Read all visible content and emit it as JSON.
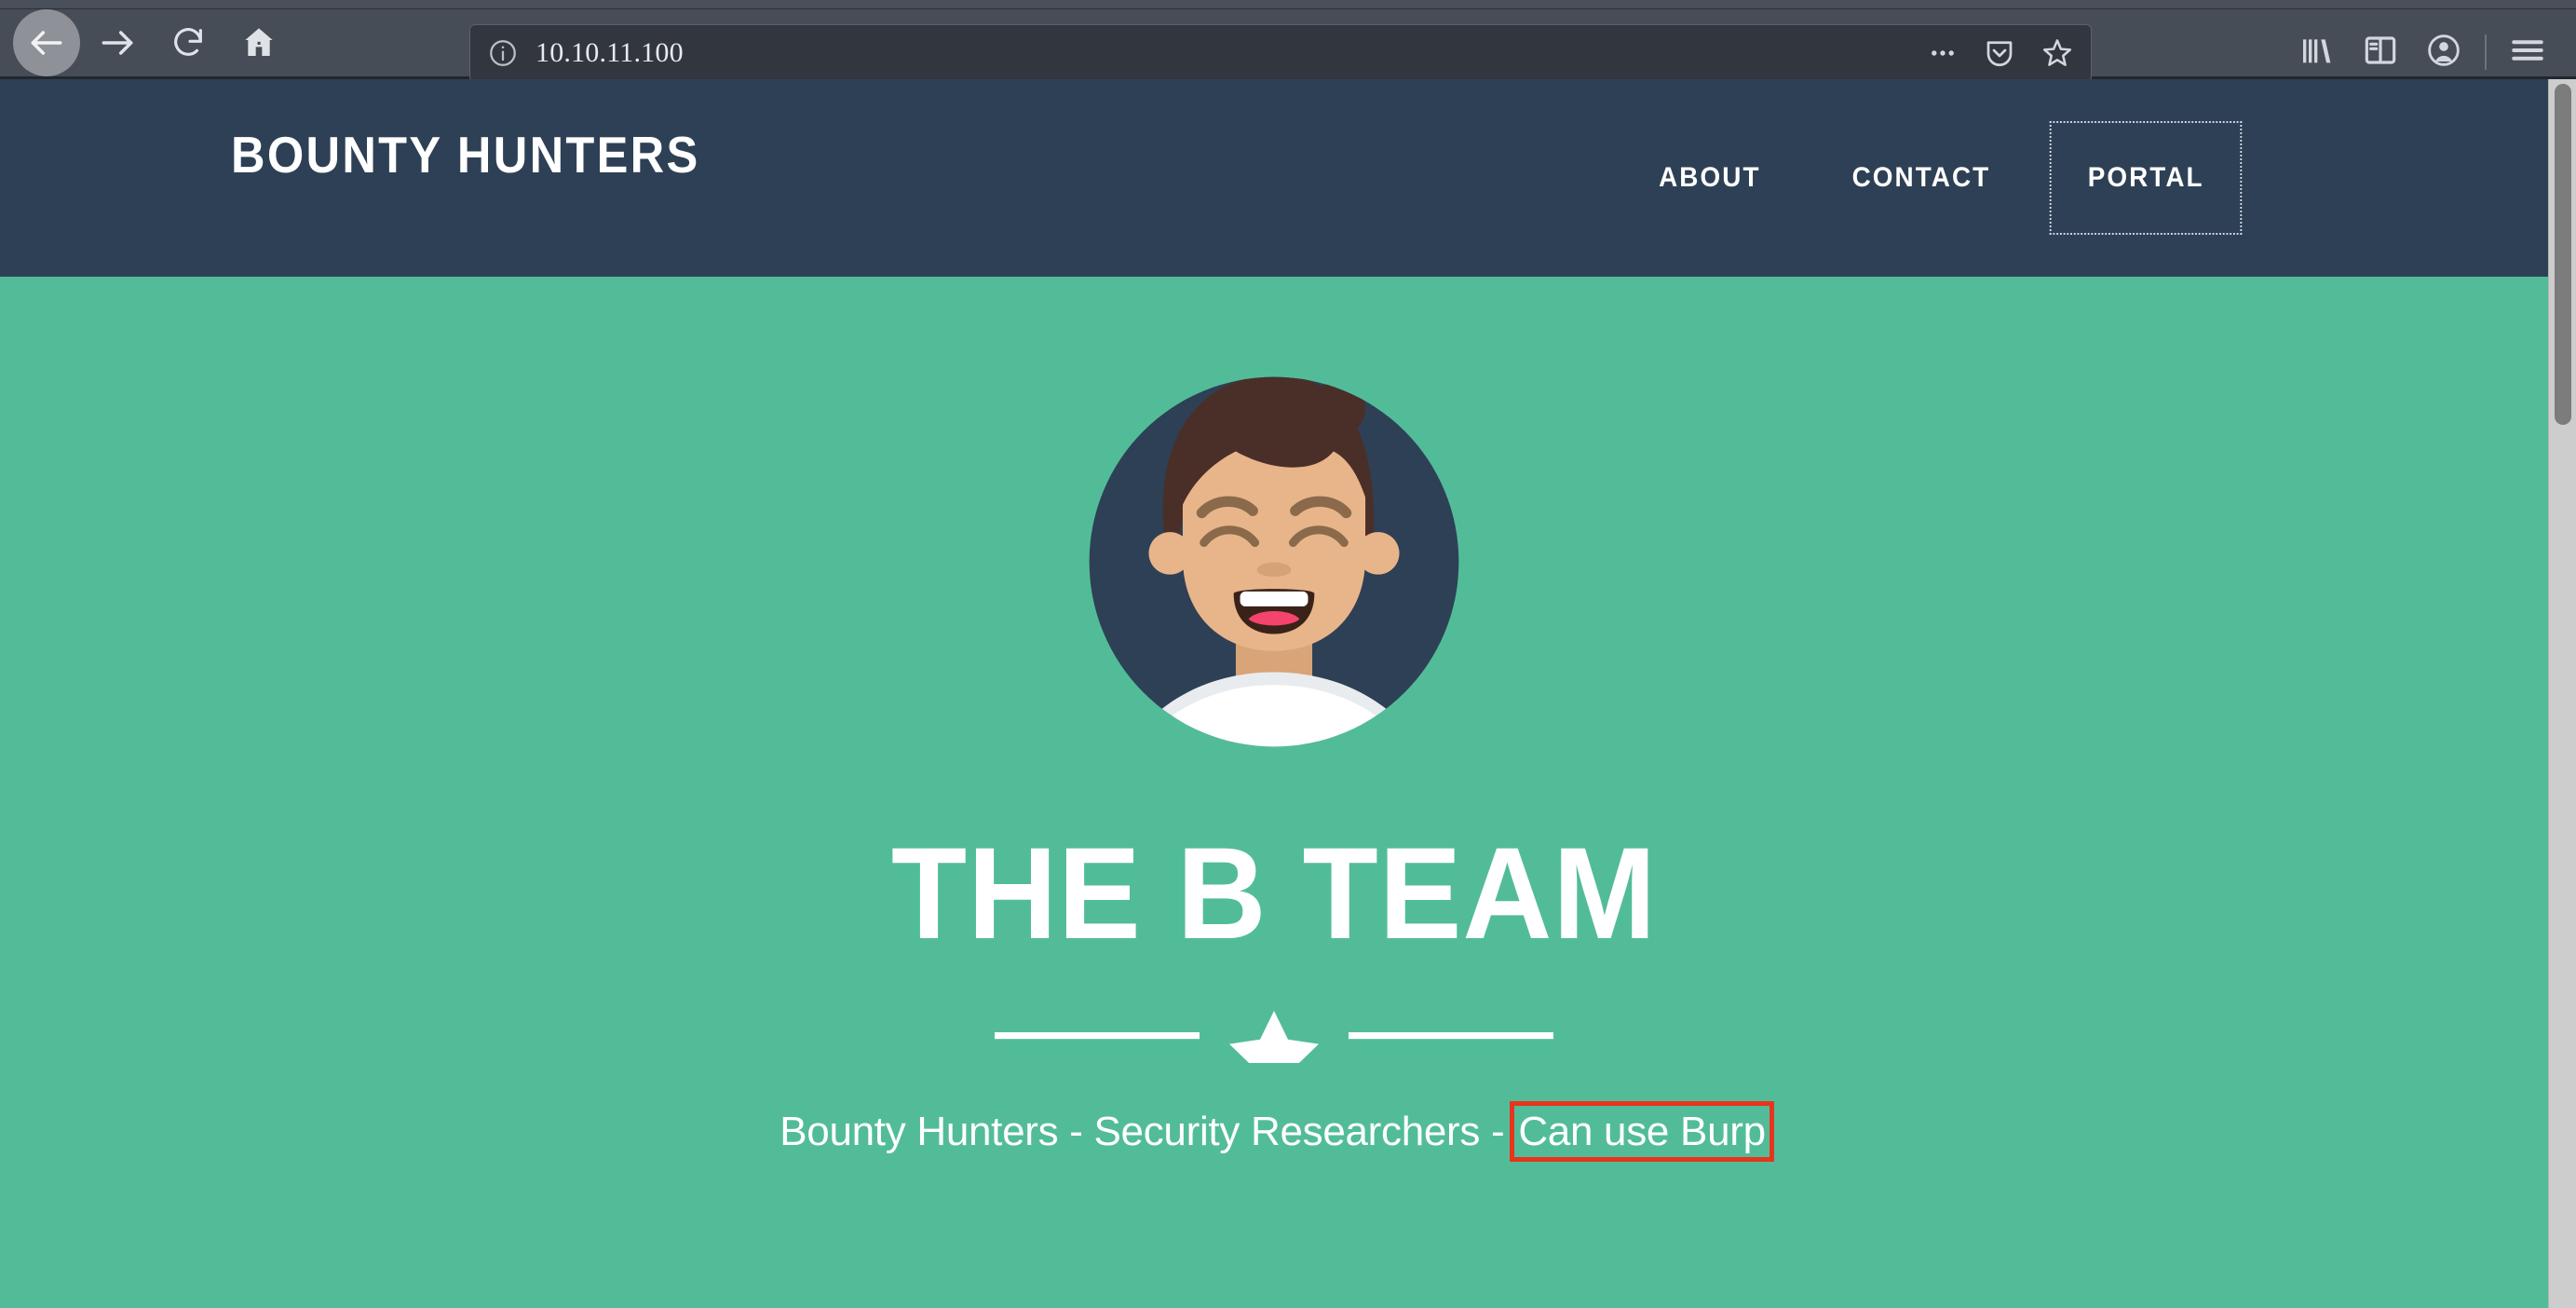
{
  "browser": {
    "back_icon": "back-arrow-icon",
    "forward_icon": "forward-arrow-icon",
    "reload_icon": "reload-icon",
    "home_icon": "home-icon",
    "identity_icon": "info-circle-icon",
    "url_value": "10.10.11.100",
    "url_placeholder": "Search or enter address",
    "page_actions_icon": "ellipsis-icon",
    "pocket_icon": "pocket-shield-icon",
    "bookmark_icon": "star-icon",
    "library_icon": "library-icon",
    "sidebar_icon": "sidebar-icon",
    "account_icon": "account-icon",
    "menu_icon": "hamburger-menu-icon"
  },
  "site": {
    "brand": "BOUNTY HUNTERS",
    "nav": [
      {
        "label": "ABOUT",
        "name": "nav-link-about"
      },
      {
        "label": "CONTACT",
        "name": "nav-link-contact"
      },
      {
        "label": "PORTAL",
        "name": "nav-link-portal",
        "focused": true
      }
    ],
    "hero": {
      "avatar_icon": "avatar-illustration",
      "title": "THE B TEAM",
      "divider_icon": "star-divider-icon",
      "tagline_prefix": "Bounty Hunters - Security Researchers - ",
      "tagline_highlight": "Can use Burp"
    }
  },
  "colors": {
    "header_bg": "#2e4055",
    "hero_bg": "#52bc99",
    "text_on_dark": "#ffffff",
    "annotation_red": "#e8341c",
    "avatar_circle": "#2e4055",
    "avatar_hair": "#4a2f28",
    "avatar_skin": "#e8b58a",
    "avatar_shirt": "#ffffff",
    "avatar_mouth": "#f4436c",
    "chrome_bg": "#474d57",
    "urlbar_bg": "#32363f"
  },
  "scrollbar": {
    "thumb_top_pct": 0,
    "thumb_height_pct": 28
  }
}
